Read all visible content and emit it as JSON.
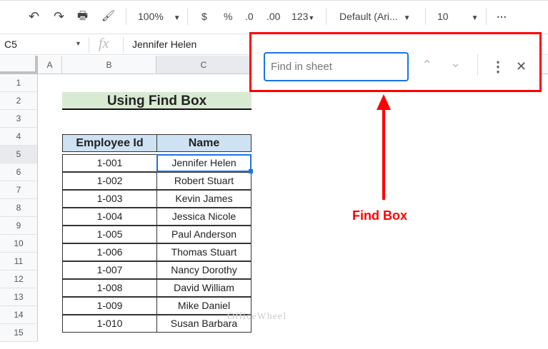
{
  "toolbar": {
    "undo": "↶",
    "redo": "↷",
    "print": "🖶",
    "paint": "🖌",
    "zoom": "100%",
    "currency": "$",
    "percent": "%",
    "dec_less": ".0",
    "dec_more": ".00",
    "format": "123",
    "font": "Default (Ari...",
    "size": "10",
    "more": "⋯"
  },
  "formula_bar": {
    "cell_ref": "C5",
    "fx": "fx",
    "value": "Jennifer Helen"
  },
  "columns": [
    "A",
    "B",
    "C"
  ],
  "rows": [
    "1",
    "2",
    "3",
    "4",
    "5",
    "6",
    "7",
    "8",
    "9",
    "10",
    "11",
    "12",
    "13",
    "14",
    "15"
  ],
  "sheet": {
    "title": "Using Find Box",
    "headers": [
      "Employee Id",
      "Name"
    ],
    "data": [
      [
        "1-001",
        "Jennifer Helen"
      ],
      [
        "1-002",
        "Robert Stuart"
      ],
      [
        "1-003",
        "Kevin James"
      ],
      [
        "1-004",
        "Jessica Nicole"
      ],
      [
        "1-005",
        "Paul Anderson"
      ],
      [
        "1-006",
        "Thomas Stuart"
      ],
      [
        "1-007",
        "Nancy Dorothy"
      ],
      [
        "1-008",
        "David William"
      ],
      [
        "1-009",
        "Mike Daniel"
      ],
      [
        "1-010",
        "Susan Barbara"
      ]
    ]
  },
  "find": {
    "placeholder": "Find in sheet",
    "up": "⌃",
    "down": "⌄",
    "menu": "⋮",
    "close": "✕"
  },
  "annotation": {
    "label": "Find Box",
    "color": "#ff0000"
  },
  "watermark": "OfficeWheel"
}
